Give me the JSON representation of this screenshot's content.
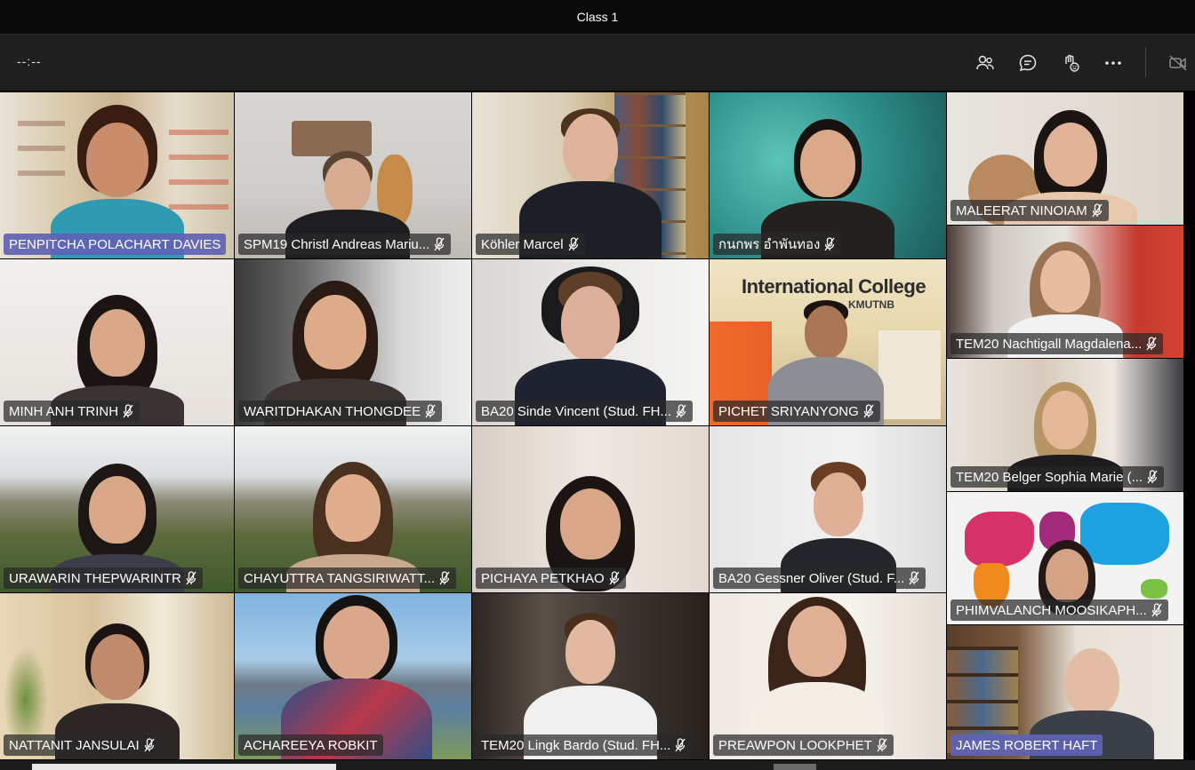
{
  "window": {
    "title": "Class 1"
  },
  "toolbar": {
    "timer": "--:--",
    "buttons": [
      "participants-icon",
      "chat-icon",
      "reactions-icon",
      "more-icon",
      "camera-off-icon"
    ]
  },
  "participants": [
    {
      "name": "PENPITCHA POLACHART DAVIES",
      "speaking": true,
      "muted": false
    },
    {
      "name": "SPM19 Christl Andreas Mariu...",
      "speaking": false,
      "muted": true
    },
    {
      "name": "Köhler Marcel",
      "speaking": false,
      "muted": true
    },
    {
      "name": "กนกพร อำพันทอง",
      "speaking": false,
      "muted": true
    },
    {
      "name": "MALEERAT NINOIAM",
      "speaking": false,
      "muted": true
    },
    {
      "name": "MINH ANH TRINH",
      "speaking": false,
      "muted": true
    },
    {
      "name": "WARITDHAKAN THONGDEE",
      "speaking": false,
      "muted": true
    },
    {
      "name": "BA20 Sinde Vincent (Stud. FH...",
      "speaking": false,
      "muted": true
    },
    {
      "name": "PICHET SRIYANYONG",
      "speaking": false,
      "muted": true
    },
    {
      "name": "TEM20 Nachtigall Magdalena...",
      "speaking": false,
      "muted": true
    },
    {
      "name": "TEM20 Belger Sophia Marie (...",
      "speaking": false,
      "muted": true
    },
    {
      "name": "URAWARIN THEPWARINTR",
      "speaking": false,
      "muted": true
    },
    {
      "name": "CHAYUTTRA TANGSIRIWATT...",
      "speaking": false,
      "muted": true
    },
    {
      "name": "PICHAYA PETKHAO",
      "speaking": false,
      "muted": true
    },
    {
      "name": "BA20 Gessner Oliver (Stud. F...",
      "speaking": false,
      "muted": true
    },
    {
      "name": "PHIMVALANCH MOOSIKAPH...",
      "speaking": false,
      "muted": true
    },
    {
      "name": "NATTANIT JANSULAI",
      "speaking": false,
      "muted": true
    },
    {
      "name": "ACHAREEYA ROBKIT",
      "speaking": false,
      "muted": false
    },
    {
      "name": "TEM20 Lingk Bardo (Stud. FH...",
      "speaking": false,
      "muted": true
    },
    {
      "name": "PREAWPON LOOKPHET",
      "speaking": false,
      "muted": true
    },
    {
      "name": "JAMES ROBERT HAFT",
      "speaking": true,
      "muted": false
    }
  ],
  "backgrounds": {
    "college_sign": "International College",
    "college_sub": "KMUTNB"
  },
  "colors": {
    "speaker_plate": "#6062b4",
    "toolbar": "#1f1f1f",
    "titlebar": "#0a0a0a"
  }
}
